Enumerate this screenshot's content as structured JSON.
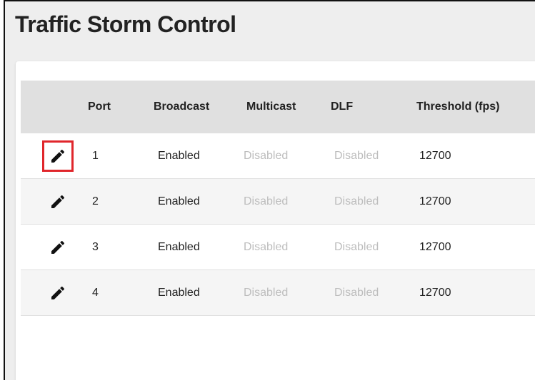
{
  "page": {
    "title": "Traffic Storm Control"
  },
  "table": {
    "columns": [
      "",
      "Port",
      "Broadcast",
      "Multicast",
      "DLF",
      "Threshold (fps)"
    ],
    "rows": [
      {
        "port": "1",
        "broadcast": "Enabled",
        "multicast": "Disabled",
        "dlf": "Disabled",
        "threshold": "12700"
      },
      {
        "port": "2",
        "broadcast": "Enabled",
        "multicast": "Disabled",
        "dlf": "Disabled",
        "threshold": "12700"
      },
      {
        "port": "3",
        "broadcast": "Enabled",
        "multicast": "Disabled",
        "dlf": "Disabled",
        "threshold": "12700"
      },
      {
        "port": "4",
        "broadcast": "Enabled",
        "multicast": "Disabled",
        "dlf": "Disabled",
        "threshold": "12700"
      }
    ],
    "row_action_icon": "pencil-icon"
  },
  "colors": {
    "page_background": "#eeeeee",
    "card_background": "#ffffff",
    "header_background": "#e0e0e0",
    "alt_row_background": "#f5f5f5",
    "disabled_text": "#bdbdbd",
    "highlight_border": "#e0262b"
  }
}
